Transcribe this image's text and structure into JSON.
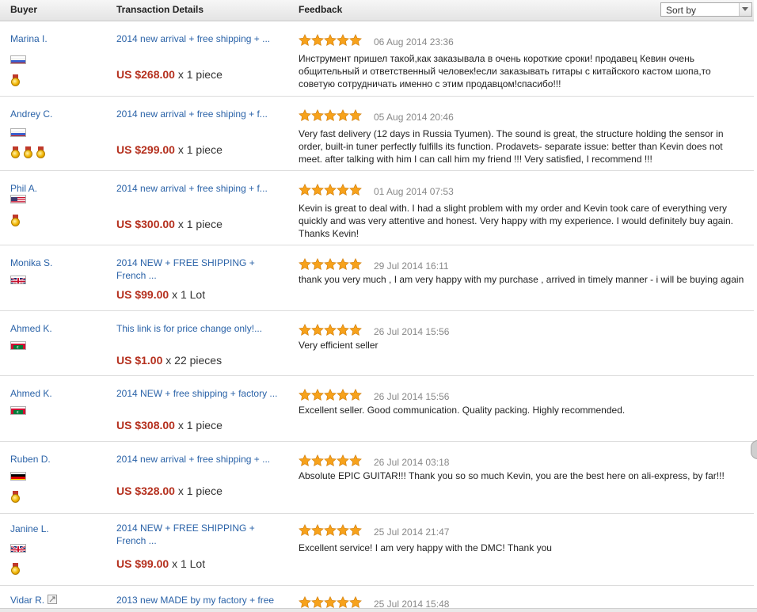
{
  "header": {
    "buyer": "Buyer",
    "transaction": "Transaction Details",
    "feedback": "Feedback",
    "sort_label": "Sort by"
  },
  "rows": [
    {
      "buyer": "Marina I.",
      "flag": "ru",
      "medals": 1,
      "title": "2014 new arrival + free shipping + ...",
      "price": "US $268.00",
      "qty": "x 1 piece",
      "rating": 5,
      "date": "06 Aug 2014 23:36",
      "feedback": "Инструмент пришел такой,как заказывала в очень короткие сроки! продавец Кевин очень общительный и ответственный человек!если заказывать гитары с китайского кастом шопа,то советую сотрудничать именно с этим продавцом!спасибо!!!"
    },
    {
      "buyer": "Andrey C.",
      "flag": "ru",
      "medals": 3,
      "title": "2014 new arrival + free shiping + f...",
      "price": "US $299.00",
      "qty": "x 1 piece",
      "rating": 5,
      "date": "05 Aug 2014 20:46",
      "feedback": "Very fast delivery (12 days in Russia Tyumen). The sound is great, the structure holding the sensor in order, built-in tuner perfectly fulfills its function. Prodavets- separate issue: better than Kevin does not meet. after talking with him I can call him my friend !!! Very satisfied, I recommend !!!"
    },
    {
      "buyer": "Phil A.",
      "flag": "us",
      "medals": 1,
      "title": "2014 new arrival + free shiping + f...",
      "price": "US $300.00",
      "qty": "x 1 piece",
      "rating": 5,
      "date": "01 Aug 2014 07:53",
      "feedback": "Kevin is great to deal with. I had a slight problem with my order and Kevin took care of everything very quickly and was very attentive and honest. Very happy with my experience. I would definitely buy again. Thanks Kevin!"
    },
    {
      "buyer": "Monika S.",
      "flag": "gb",
      "medals": 0,
      "title": "2014 NEW + FREE SHIPPING + French ...",
      "price": "US $99.00",
      "qty": "x 1 Lot",
      "rating": 5,
      "date": "29 Jul 2014 16:11",
      "feedback": "thank you very much , I am very happy with my purchase , arrived in timely manner - i will be buying again"
    },
    {
      "buyer": "Ahmed K.",
      "flag": "mv",
      "medals": 0,
      "title": "This link is for price change only!...",
      "price": "US $1.00",
      "qty": "x 22 pieces",
      "rating": 5,
      "date": "26 Jul 2014 15:56",
      "feedback": "Very efficient seller"
    },
    {
      "buyer": "Ahmed K.",
      "flag": "mv",
      "medals": 0,
      "title": "2014 NEW + free shipping + factory ...",
      "price": "US $308.00",
      "qty": "x 1 piece",
      "rating": 5,
      "date": "26 Jul 2014 15:56",
      "feedback": "Excellent seller. Good communication. Quality packing. Highly recommended."
    },
    {
      "buyer": "Ruben D.",
      "flag": "de",
      "medals": 1,
      "title": "2014 new arrival + free shipping + ...",
      "price": "US $328.00",
      "qty": "x 1 piece",
      "rating": 5,
      "date": "26 Jul 2014 03:18",
      "feedback": "Absolute EPIC GUITAR!!! Thank you so so much Kevin, you are the best here on ali-express, by far!!!"
    },
    {
      "buyer": "Janine L.",
      "flag": "gb",
      "medals": 1,
      "title": "2014 NEW + FREE SHIPPING + French ...",
      "price": "US $99.00",
      "qty": "x 1 Lot",
      "rating": 5,
      "date": "25 Jul 2014 21:47",
      "feedback": "Excellent service! I am very happy with the DMC! Thank you"
    },
    {
      "buyer": "Vidar R.",
      "flag": "",
      "medals": 0,
      "title": "2013 new MADE by my factory + free ...",
      "price": "",
      "qty": "",
      "rating": 5,
      "date": "25 Jul 2014 15:48",
      "feedback": ""
    }
  ],
  "colors": {
    "link": "#2b63a8",
    "price": "#b5301e",
    "star": "#f7a21b"
  }
}
